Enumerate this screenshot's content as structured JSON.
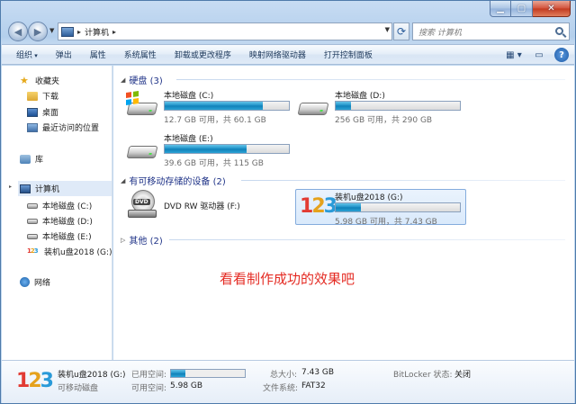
{
  "address": {
    "path": "计算机",
    "search_placeholder": "搜索 计算机"
  },
  "toolbar": {
    "organize": "组织",
    "eject": "弹出",
    "properties": "属性",
    "system_properties": "系统属性",
    "uninstall": "卸载或更改程序",
    "map_drive": "映射网络驱动器",
    "control_panel": "打开控制面板"
  },
  "sidebar": {
    "favorites": "收藏夹",
    "downloads": "下载",
    "desktop": "桌面",
    "recent": "最近访问的位置",
    "libraries": "库",
    "computer": "计算机",
    "drive_c": "本地磁盘 (C:)",
    "drive_d": "本地磁盘 (D:)",
    "drive_e": "本地磁盘 (E:)",
    "drive_g": "装机u盘2018 (G:)",
    "network": "网络"
  },
  "groups": {
    "hdd": "硬盘 (3)",
    "removable": "有可移动存储的设备 (2)",
    "other": "其他 (2)"
  },
  "drives": {
    "c": {
      "name": "本地磁盘 (C:)",
      "free": "12.7 GB 可用，共 60.1 GB",
      "used_fraction": 0.79
    },
    "d": {
      "name": "本地磁盘 (D:)",
      "free": "256 GB 可用，共 290 GB",
      "used_fraction": 0.12
    },
    "e": {
      "name": "本地磁盘 (E:)",
      "free": "39.6 GB 可用，共 115 GB",
      "used_fraction": 0.66
    },
    "dvd": {
      "name": "DVD RW 驱动器 (F:)"
    },
    "g": {
      "name": "装机u盘2018 (G:)",
      "free": "5.98 GB 可用，共 7.43 GB",
      "used_fraction": 0.2
    }
  },
  "overlay": "看看制作成功的效果吧",
  "details": {
    "name": "装机u盘2018 (G:)",
    "type": "可移动磁盘",
    "used_label": "已用空间:",
    "free_label": "可用空间:",
    "free_value": "5.98 GB",
    "total_label": "总大小:",
    "total_value": "7.43 GB",
    "fs_label": "文件系统:",
    "fs_value": "FAT32",
    "bitlocker_label": "BitLocker 状态:",
    "bitlocker_value": "关闭",
    "used_fraction": 0.2
  },
  "colors": {
    "bar_fill": "#1a8fc6",
    "overlay_text": "#e42a22",
    "group_header": "#1e3287"
  }
}
